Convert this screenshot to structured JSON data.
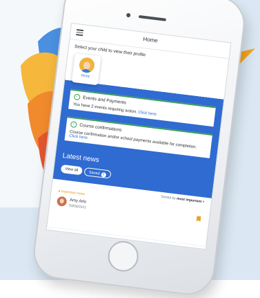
{
  "header": {
    "title": "Home",
    "menu_icon": "menu-icon"
  },
  "profile": {
    "prompt": "Select your child to view their profile",
    "child_name": "Kirsty"
  },
  "cards": [
    {
      "title": "Events and Payments",
      "text": "You have 2 events requiring action.",
      "link": "Click here",
      "icon": "check-circle-icon"
    },
    {
      "title": "Course confirmations",
      "text": "Course confirmation and/or school payments available for completion.",
      "link": "Click here",
      "icon": "check-circle-icon"
    }
  ],
  "news": {
    "title": "Latest news",
    "view_all": "View all",
    "saved": "Saved",
    "saved_count": "1",
    "sort_label": "Sorted by",
    "sort_value": "most important",
    "important_tag": "Important news",
    "item_name": "Amy Arlo",
    "item_date": "03/03/2021"
  },
  "colors": {
    "primary_blue": "#2f6bd1",
    "accent_green": "#3a9d5a",
    "accent_orange": "#e9a21b"
  }
}
